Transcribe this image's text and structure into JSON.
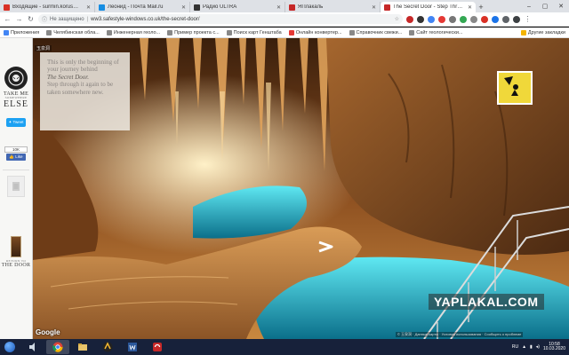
{
  "browser": {
    "tabs": [
      {
        "title": "Входящие - surmin.korus@gmail.com",
        "color": "#d93025",
        "active": false
      },
      {
        "title": "Леонид - Почта Mail.ru",
        "color": "#168de2",
        "active": false
      },
      {
        "title": "Радио ULTRA",
        "color": "#333333",
        "active": false
      },
      {
        "title": "ЯПлакаль",
        "color": "#c62828",
        "active": false
      },
      {
        "title": "The Secret Door - Step Through",
        "color": "#c62828",
        "active": true
      }
    ],
    "new_tab_symbol": "+",
    "window_controls": {
      "minimize": "–",
      "maximize": "▢",
      "close": "✕"
    },
    "address": {
      "security_text": "Не защищено",
      "url": "ww3.safestyle-windows.co.uk/the-secret-door/"
    },
    "bookmarks": [
      {
        "label": "Приложения",
        "color": "#4285f4"
      },
      {
        "label": "Челябинская обла...",
        "color": "#888888"
      },
      {
        "label": "Инженерная геоло...",
        "color": "#888888"
      },
      {
        "label": "Пример проекта с...",
        "color": "#888888"
      },
      {
        "label": "Поиск карт Генштаба",
        "color": "#888888"
      },
      {
        "label": "Онлайн конвертер...",
        "color": "#e53935"
      },
      {
        "label": "Справочник свежи...",
        "color": "#888888"
      },
      {
        "label": "Сайт геологически...",
        "color": "#888888"
      }
    ],
    "other_bookmarks": "Другие закладки"
  },
  "page": {
    "sidebar": {
      "logo_line1": "TAKE ME",
      "logo_line2": "SOMEWHERE",
      "logo_line3": "ELSE",
      "tweet_label": "Tweet",
      "like_count": "10K",
      "like_label": "Like",
      "return_line1": "RETURN TO",
      "return_line2": "THE DOOR"
    },
    "scene": {
      "place_tag": "玉泉洞",
      "info_line1": "This is only the beginning of your journey behind",
      "info_script": "The Secret Door.",
      "info_line2": "Step through it again to be taken somewhere new.",
      "google": "Google",
      "attribution": "© 玉泉洞 · Данные карты · Условия использования · Сообщить о проблеме",
      "watermark": "YAPLAKAL.COM",
      "accent_water": "#2fd3e6",
      "accent_rock": "#b36a2e"
    }
  },
  "taskbar": {
    "apps": [
      "explorer",
      "chrome",
      "files",
      "winamp",
      "word",
      "yaplakal"
    ],
    "language": "RU",
    "time": "10:58",
    "date": "10.03.2020"
  }
}
